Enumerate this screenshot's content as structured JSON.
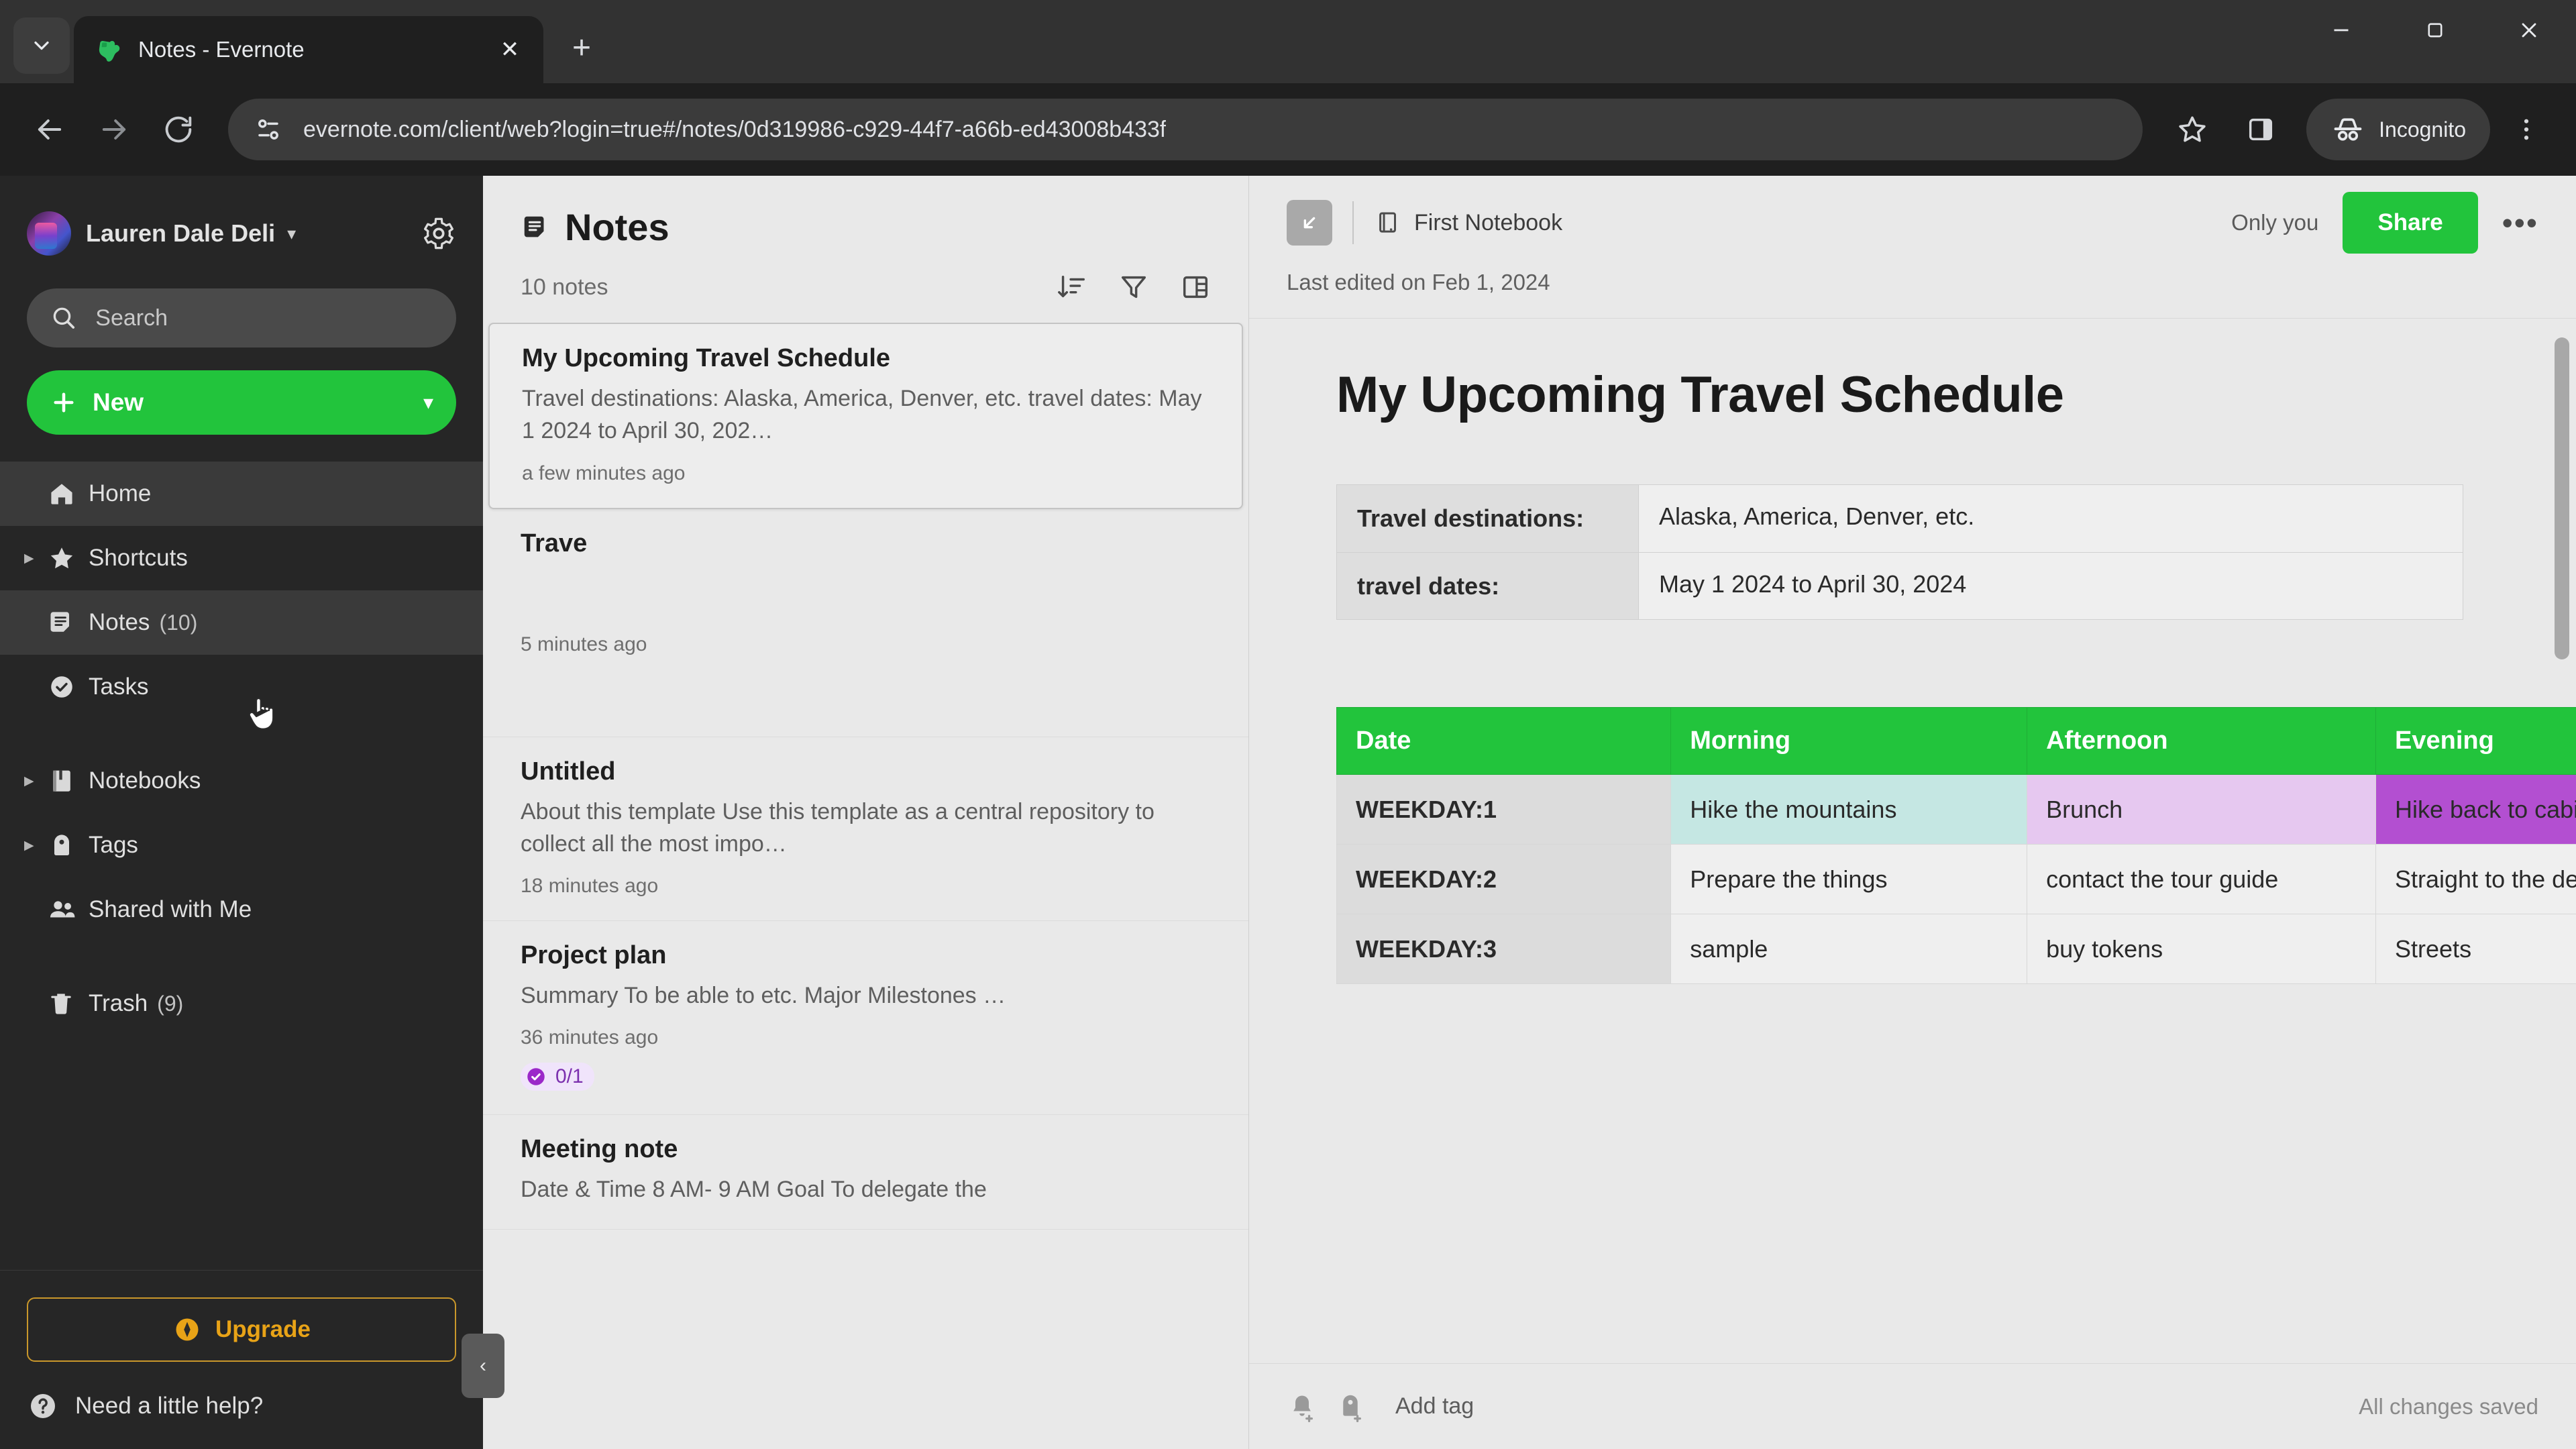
{
  "browser": {
    "tab": {
      "title": "Notes - Evernote",
      "favicon": "evernote-elephant-icon"
    },
    "new_tab_label": "+",
    "url": "evernote.com/client/web?login=true#/notes/0d319986-c929-44f7-a66b-ed43008b433f",
    "profile_label": "Incognito",
    "window_controls": {
      "minimize": "—",
      "maximize": "❐",
      "close": "✕"
    }
  },
  "sidebar": {
    "user_name": "Lauren Dale Deli",
    "search_placeholder": "Search",
    "new_button_label": "New",
    "items": [
      {
        "label": "Home",
        "count": "",
        "icon": "home-icon",
        "twisty": false,
        "active": true
      },
      {
        "label": "Shortcuts",
        "count": "",
        "icon": "star-icon",
        "twisty": true,
        "active": false
      },
      {
        "label": "Notes",
        "count": "(10)",
        "icon": "notes-icon",
        "twisty": false,
        "active": true
      },
      {
        "label": "Tasks",
        "count": "",
        "icon": "task-icon",
        "twisty": false,
        "active": false
      },
      {
        "label": "Notebooks",
        "count": "",
        "icon": "notebook-icon",
        "twisty": true,
        "active": false
      },
      {
        "label": "Tags",
        "count": "",
        "icon": "tag-icon",
        "twisty": true,
        "active": false
      },
      {
        "label": "Shared with Me",
        "count": "",
        "icon": "people-icon",
        "twisty": false,
        "active": false
      },
      {
        "label": "Trash",
        "count": "(9)",
        "icon": "trash-icon",
        "twisty": false,
        "active": false
      }
    ],
    "upgrade_label": "Upgrade",
    "help_label": "Need a little help?",
    "collapse_label": "‹"
  },
  "notelist": {
    "title": "Notes",
    "count_label": "10 notes",
    "actions": [
      "sort-icon",
      "filter-icon",
      "view-layout-icon"
    ],
    "items": [
      {
        "title": "My Upcoming Travel Schedule",
        "snippet": "Travel destinations: Alaska, America, Denver, etc. travel dates: May 1 2024 to April 30, 202…",
        "time": "a few minutes ago",
        "badge": "",
        "selected": true
      },
      {
        "title": "Trave",
        "snippet": "",
        "time": "5 minutes ago",
        "badge": "",
        "selected": false
      },
      {
        "title": "Untitled",
        "snippet": "About this template Use this template as a central repository to collect all the most impo…",
        "time": "18 minutes ago",
        "badge": "",
        "selected": false
      },
      {
        "title": "Project plan",
        "snippet": "Summary To be able to etc. Major Milestones …",
        "time": "36 minutes ago",
        "badge": "0/1",
        "selected": false
      },
      {
        "title": "Meeting note",
        "snippet": "Date & Time 8 AM- 9 AM Goal To delegate the",
        "time": "",
        "badge": "",
        "selected": false
      }
    ]
  },
  "editor": {
    "notebook": "First Notebook",
    "only_you": "Only you",
    "share_label": "Share",
    "more_label": "•••",
    "last_edited": "Last edited on Feb 1, 2024",
    "note_title": "My Upcoming Travel Schedule",
    "info_table": [
      {
        "key": "Travel destinations:",
        "value": "Alaska, America, Denver, etc."
      },
      {
        "key": "travel dates:",
        "value": "May 1 2024 to April 30, 2024"
      }
    ],
    "schedule_headers": [
      "Date",
      "Morning",
      "Afternoon",
      "Evening"
    ],
    "schedule_rows": [
      {
        "date": "WEEKDAY:1",
        "morning": "Hike the mountains",
        "afternoon": "Brunch",
        "evening": "Hike back to cabin",
        "styles": {
          "morning": "c-teal",
          "afternoon": "c-lav",
          "evening": "c-purple"
        }
      },
      {
        "date": "WEEKDAY:2",
        "morning": "Prepare the things",
        "afternoon": "contact the tour guide",
        "evening": "Straight to the destination",
        "styles": {
          "morning": "c-plain",
          "afternoon": "c-plain",
          "evening": "c-plain"
        }
      },
      {
        "date": "WEEKDAY:3",
        "morning": "sample",
        "afternoon": "buy tokens",
        "evening": "Streets",
        "styles": {
          "morning": "c-plain",
          "afternoon": "c-plain",
          "evening": "c-plain"
        }
      }
    ],
    "footer": {
      "add_tag": "Add tag",
      "status": "All changes saved"
    }
  },
  "colors": {
    "evernote_green": "#22c43c",
    "header_green": "#22c43c",
    "cell_teal": "#c5e7e3",
    "cell_lavender": "#e6c8f0",
    "cell_purple": "#b34fd1",
    "upgrade_gold": "#e8a317",
    "badge_purple": "#7b2fae",
    "chrome_dark": "#1f1f1f",
    "sidebar_dark": "#262626",
    "app_bg": "#e9e9e9"
  }
}
